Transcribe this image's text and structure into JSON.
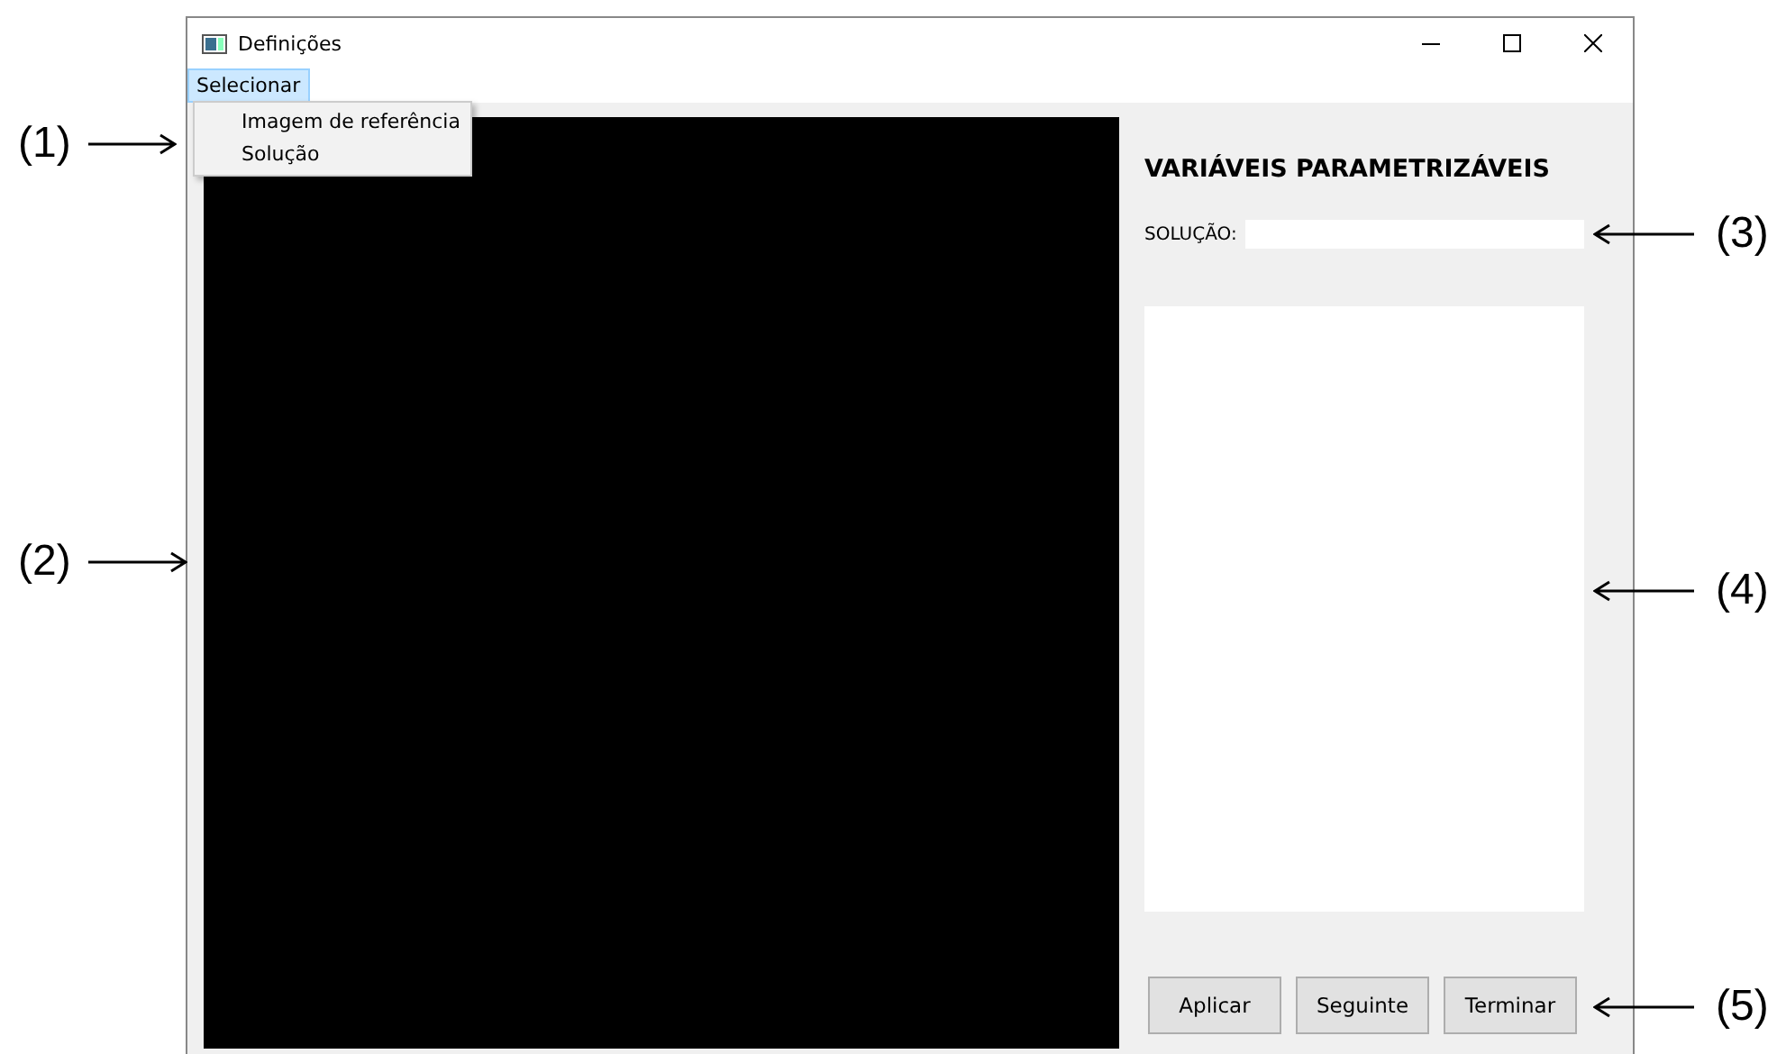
{
  "window": {
    "title": "Definições"
  },
  "menu_bar": [
    {
      "label": "Selecionar",
      "selected": true
    }
  ],
  "dropdown": {
    "items": [
      "Imagem de referência",
      "Solução"
    ]
  },
  "panel": {
    "title": "VARIÁVEIS PARAMETRIZÁVEIS",
    "solution_label": "SOLUÇÃO:"
  },
  "buttons": [
    "Aplicar",
    "Seguinte",
    "Terminar"
  ],
  "callouts": [
    {
      "label": "(1)",
      "kind": "left"
    },
    {
      "label": "(2)",
      "kind": "left"
    },
    {
      "label": "(3)",
      "kind": "right"
    },
    {
      "label": "(4)",
      "kind": "right"
    },
    {
      "label": "(5)",
      "kind": "right"
    }
  ]
}
